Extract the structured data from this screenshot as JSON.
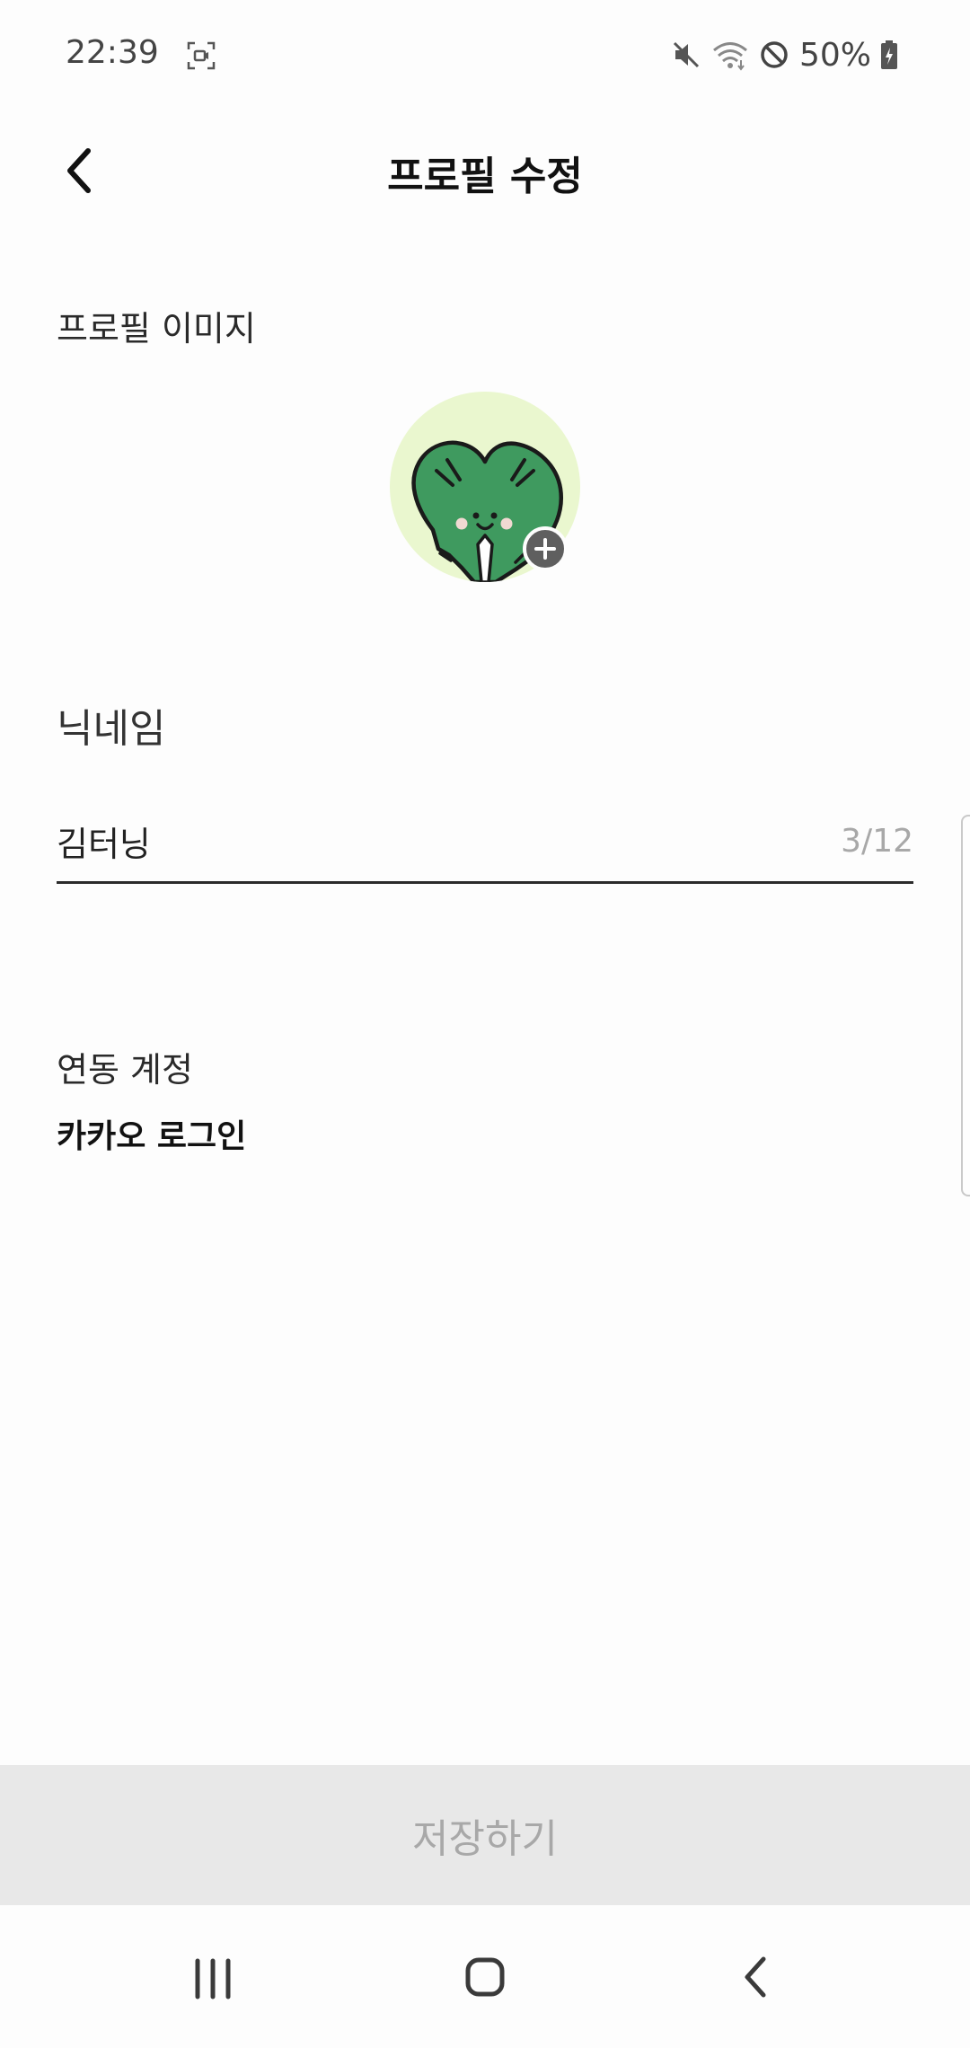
{
  "status_bar": {
    "time": "22:39",
    "battery": "50%",
    "icons": [
      "screen-record-icon",
      "mute-icon",
      "wifi-icon",
      "do-not-disturb-icon",
      "battery-charging-icon"
    ]
  },
  "header": {
    "title": "프로필 수정",
    "back_icon": "chevron-left-icon"
  },
  "profile_image": {
    "label": "프로필 이미지",
    "add_icon": "plus-icon",
    "accent": "#eaf7cf",
    "character_color": "#3f9a5f"
  },
  "nickname": {
    "label": "닉네임",
    "value": "김터닝",
    "counter": "3/12"
  },
  "linked_account": {
    "label": "연동 계정",
    "value": "카카오 로그인"
  },
  "save": {
    "label": "저장하기"
  },
  "nav_bar": {
    "icons": [
      "recent-apps-icon",
      "home-icon",
      "back-icon"
    ]
  }
}
